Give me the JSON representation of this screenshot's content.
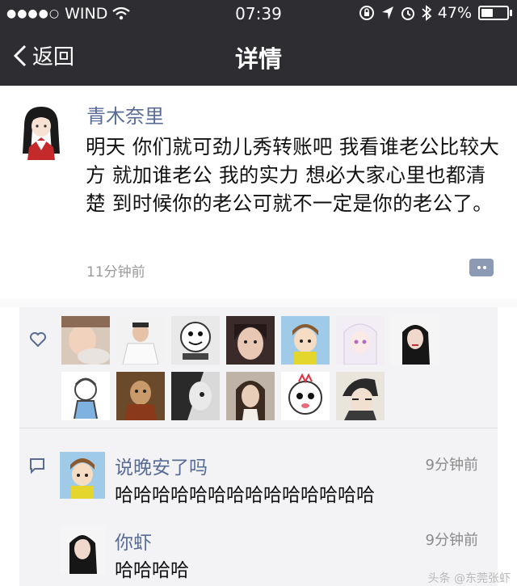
{
  "status_bar": {
    "signal_dots": "●●●●○",
    "carrier": "WIND",
    "time": "07:39",
    "battery": "47%",
    "battery_level": 0.47,
    "icons": [
      "wifi-icon",
      "rotation-lock-icon",
      "location-icon",
      "alarm-icon",
      "bluetooth-icon",
      "battery-icon"
    ]
  },
  "nav": {
    "back_label": "返回",
    "title": "详情"
  },
  "post": {
    "author": "青木奈里",
    "text": "明天 你们就可劲儿秀转账吧 我看谁老公比较大方 就加谁老公 我的实力 想必大家心里也都清楚 到时候你的老公可就不一定是你的老公了。",
    "time": "11分钟前"
  },
  "likes": {
    "icon": "heart-icon",
    "avatars": [
      "avatar-1",
      "avatar-2",
      "avatar-3",
      "avatar-4",
      "avatar-5",
      "avatar-6",
      "avatar-7",
      "avatar-8",
      "avatar-9",
      "avatar-10",
      "avatar-11",
      "avatar-12",
      "avatar-13",
      "avatar-14"
    ]
  },
  "comments": [
    {
      "name": "说晚安了吗",
      "time": "9分钟前",
      "text": "哈哈哈哈哈哈哈哈哈哈哈哈哈哈"
    },
    {
      "name": "你虾",
      "time": "9分钟前",
      "text": "哈哈哈哈"
    }
  ],
  "watermark": "头条 @东莞张虾"
}
